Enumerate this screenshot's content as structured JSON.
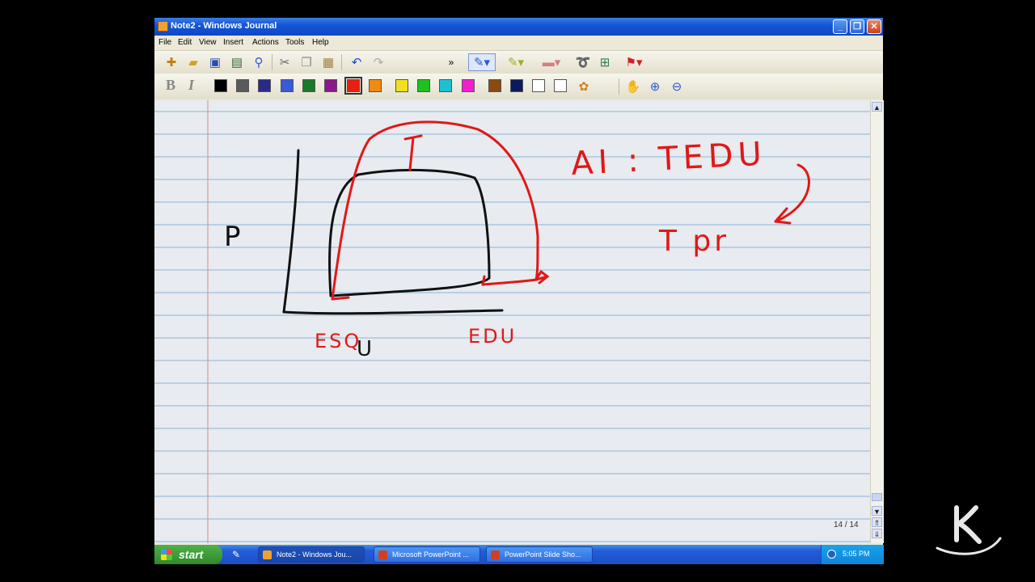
{
  "window": {
    "title": "Note2 - Windows Journal",
    "controls": [
      "minimize",
      "restore",
      "close"
    ]
  },
  "menu": [
    "File",
    "Edit",
    "View",
    "Insert",
    "Actions",
    "Tools",
    "Help"
  ],
  "toolbar": {
    "overflow_label": "»",
    "format_bold": "B",
    "format_italic": "I",
    "colors": [
      "#000000",
      "#5a5a5a",
      "#2a2a8a",
      "#3a5ad8",
      "#1a7a2a",
      "#8a1a8a",
      "#e82010",
      "#f08a10",
      "#f0e020",
      "#20c020",
      "#20c0d0",
      "#f020d0",
      "#8a4a10",
      "#0a1a5a",
      "#ffffff",
      "#ffffff"
    ],
    "selected_color": "#e82010"
  },
  "note": {
    "handwriting": {
      "left_axis": "P",
      "heading": "AI : TEDU",
      "note_line": "T pr",
      "x_tick_1": "ESQ",
      "x_tick_1_sub": "U",
      "x_tick_2": "EDU"
    },
    "page_indicator": "14 / 14"
  },
  "taskbar": {
    "start_label": "start",
    "items": [
      {
        "label": "Note2 - Windows Jou...",
        "icon_color": "#f0a030",
        "active": true
      },
      {
        "label": "Microsoft PowerPoint ...",
        "icon_color": "#d04020",
        "active": false
      },
      {
        "label": "PowerPoint Slide Sho...",
        "icon_color": "#d04020",
        "active": false
      }
    ],
    "clock": "5:05 PM"
  },
  "colors": {
    "ink_black": "#111111",
    "ink_red": "#e01818",
    "titlebar": "#1456d6",
    "rule_line": "#8ab4d8",
    "margin_line": "#d88a8a"
  }
}
